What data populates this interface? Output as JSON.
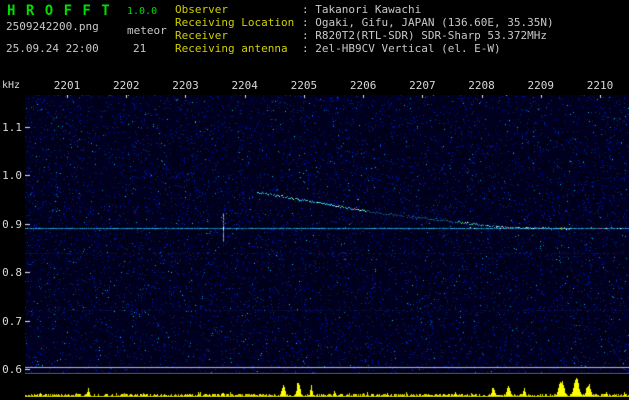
{
  "header": {
    "app_title": "H R O F F T",
    "version": "1.0.0",
    "filename": "2509242200.png",
    "mode": "meteor",
    "datetime": "25.09.24 22:00",
    "count": "21",
    "info": [
      {
        "label": "Observer",
        "value": ": Takanori Kawachi"
      },
      {
        "label": "Receiving Location",
        "value": ": Ogaki, Gifu, JAPAN (136.60E, 35.35N)"
      },
      {
        "label": "Receiver",
        "value": ": R820T2(RTL-SDR) SDR-Sharp 53.372MHz"
      },
      {
        "label": "Receiving antenna",
        "value": ": 2el-HB9CV Vertical (el. E-W)"
      }
    ]
  },
  "chart_data": {
    "type": "heatmap",
    "ylabel": "kHz",
    "x_ticks": [
      "2201",
      "2202",
      "2203",
      "2204",
      "2205",
      "2206",
      "2207",
      "2208",
      "2209",
      "2210"
    ],
    "y_ticks": [
      "1.1",
      "1.0",
      "0.9",
      "0.8",
      "0.7",
      "0.6"
    ],
    "x_range_min": [
      2200.29,
      2210.49
    ],
    "y_range_khz": [
      0.59,
      1.166
    ],
    "grid": false,
    "legend": "none",
    "carrier_khz": 0.891,
    "reference_line_khz": 0.604,
    "faint_lines_khz": [
      0.84,
      0.722
    ],
    "head_echo": {
      "t": 2203.63,
      "khz_top": 0.922,
      "khz_bottom": 0.864
    },
    "meteor_trail": [
      {
        "t": 2204.21,
        "khz": 0.966
      },
      {
        "t": 2206.2,
        "khz": 0.924
      },
      {
        "t": 2208.4,
        "khz": 0.893
      },
      {
        "t": 2209.5,
        "khz": 0.891
      }
    ],
    "activity_spikes": [
      {
        "t": 2200.55,
        "h": 0.28,
        "w": 2
      },
      {
        "t": 2201.35,
        "h": 0.45,
        "w": 2
      },
      {
        "t": 2202.3,
        "h": 0.2,
        "w": 2
      },
      {
        "t": 2203.0,
        "h": 0.18,
        "w": 2
      },
      {
        "t": 2203.62,
        "h": 0.3,
        "w": 2
      },
      {
        "t": 2204.65,
        "h": 0.75,
        "w": 3
      },
      {
        "t": 2204.9,
        "h": 0.9,
        "w": 3
      },
      {
        "t": 2205.12,
        "h": 0.6,
        "w": 2
      },
      {
        "t": 2205.5,
        "h": 0.35,
        "w": 2
      },
      {
        "t": 2206.4,
        "h": 0.2,
        "w": 2
      },
      {
        "t": 2207.1,
        "h": 0.18,
        "w": 2
      },
      {
        "t": 2207.55,
        "h": 0.28,
        "w": 2
      },
      {
        "t": 2208.2,
        "h": 0.55,
        "w": 3
      },
      {
        "t": 2208.45,
        "h": 0.7,
        "w": 3
      },
      {
        "t": 2208.72,
        "h": 0.5,
        "w": 2
      },
      {
        "t": 2209.35,
        "h": 0.9,
        "w": 5
      },
      {
        "t": 2209.6,
        "h": 0.95,
        "w": 5
      },
      {
        "t": 2209.8,
        "h": 0.75,
        "w": 4
      },
      {
        "t": 2210.1,
        "h": 0.28,
        "w": 2
      },
      {
        "t": 2210.4,
        "h": 0.2,
        "w": 2
      }
    ]
  },
  "colors": {
    "title_green": "#00dd00",
    "label_yellow": "#cfcf00",
    "text_gray": "#c8c8c8",
    "tick_text": "#d8d8d8",
    "spec_bg": "#000014",
    "carrier_cyan": "#28c8ff",
    "trail_cyan": "#3cdcff",
    "activity_yellow": "#f0f000",
    "reference_white": "#c3c3d7"
  }
}
